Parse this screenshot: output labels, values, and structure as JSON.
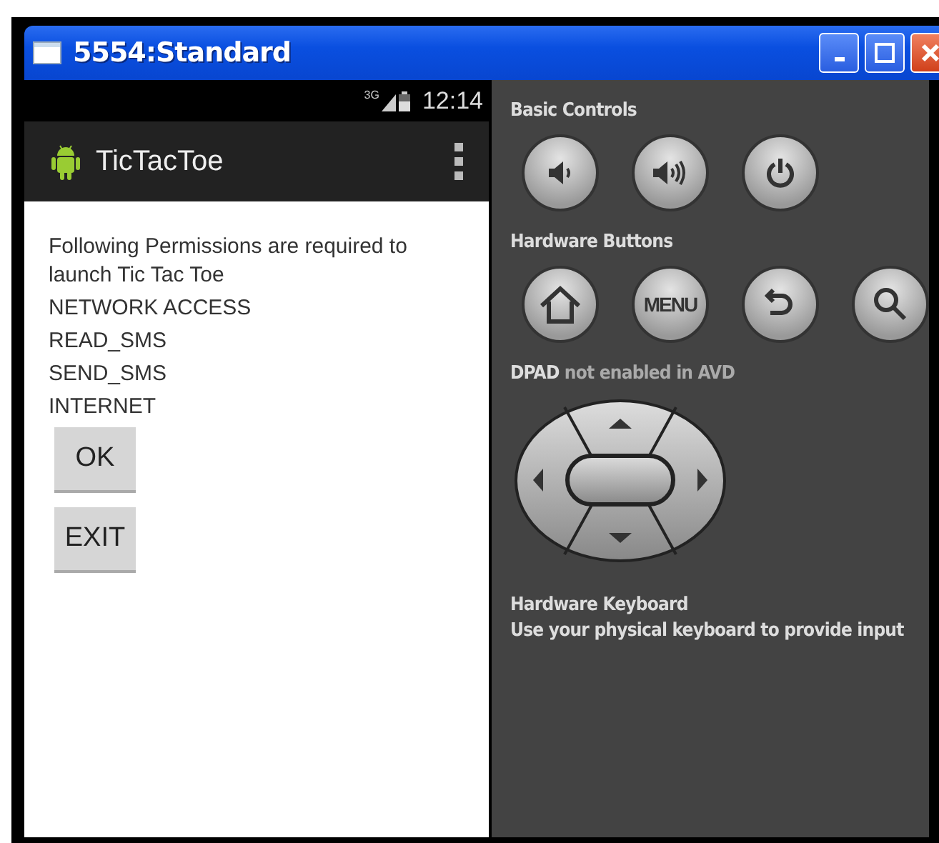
{
  "window": {
    "title": "5554:Standard"
  },
  "status_bar": {
    "network": "3G",
    "time": "12:14"
  },
  "action_bar": {
    "title": "TicTacToe"
  },
  "content": {
    "message": "Following Permissions are required to launch Tic Tac Toe",
    "permissions": [
      "NETWORK ACCESS",
      "READ_SMS",
      "SEND_SMS",
      "INTERNET"
    ],
    "buttons": [
      "OK",
      "EXIT"
    ]
  },
  "controls": {
    "sections": [
      {
        "kind": "buttons",
        "title": "Basic Controls",
        "buttons": [
          {
            "kind": "volume-down"
          },
          {
            "kind": "volume-up"
          },
          {
            "kind": "power"
          }
        ]
      },
      {
        "kind": "buttons",
        "title": "Hardware Buttons",
        "buttons": [
          {
            "kind": "home"
          },
          {
            "kind": "menu",
            "label": "MENU"
          },
          {
            "kind": "back"
          },
          {
            "kind": "search"
          }
        ]
      },
      {
        "kind": "dpad",
        "title": "**DPAD** not enabled in AVD"
      }
    ],
    "keyboard": {
      "title": "Hardware Keyboard",
      "note": "Use your physical keyboard to provide input"
    }
  }
}
